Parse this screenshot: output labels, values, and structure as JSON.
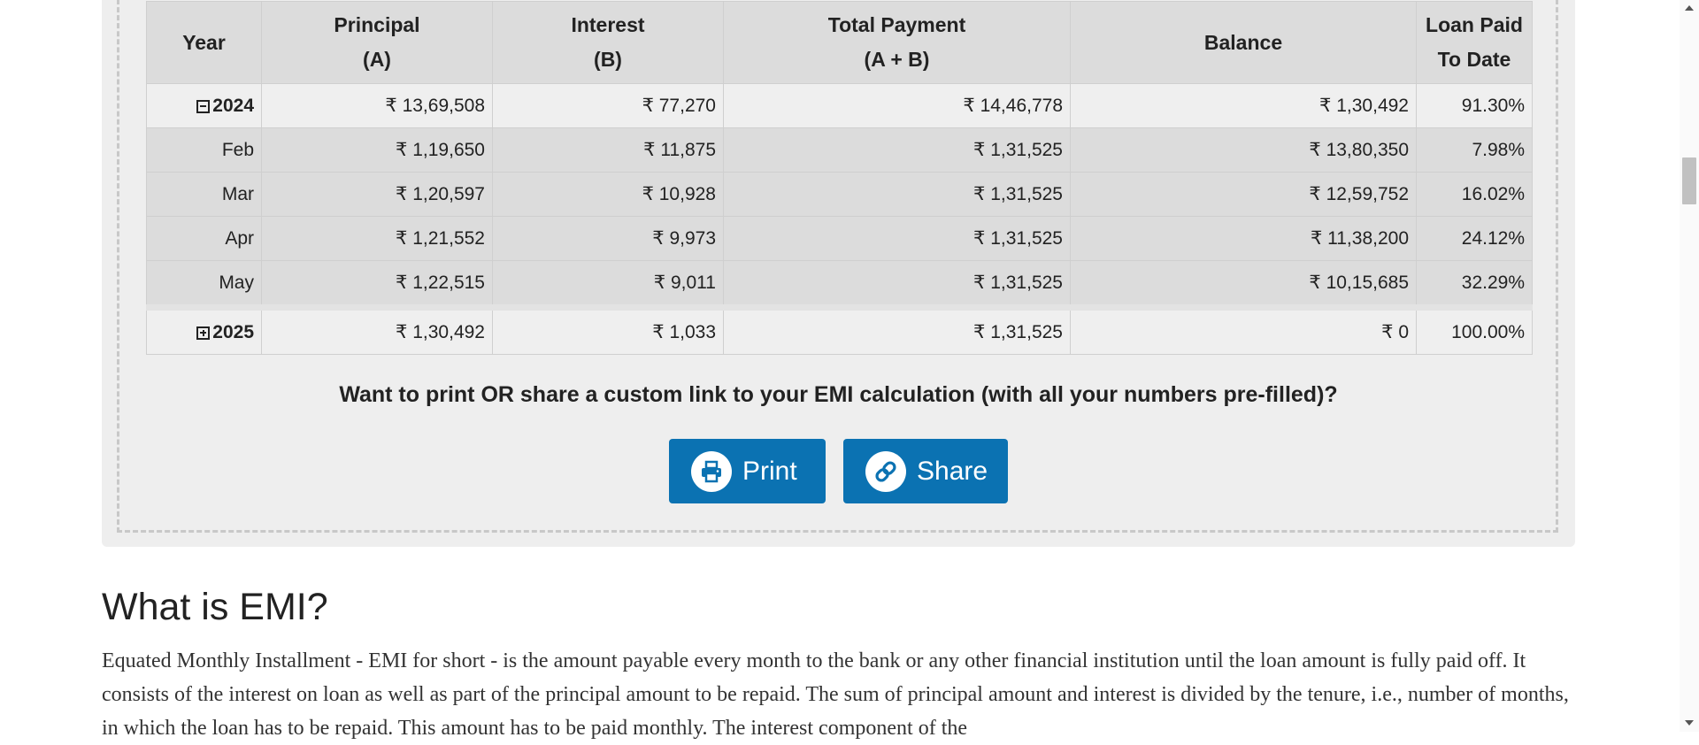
{
  "table": {
    "headers": {
      "year": "Year",
      "principal": "Principal",
      "principal_sub": "(A)",
      "interest": "Interest",
      "interest_sub": "(B)",
      "total": "Total Payment",
      "total_sub": "(A + B)",
      "balance": "Balance",
      "paid": "Loan Paid",
      "paid_sub": "To Date"
    },
    "rows": [
      {
        "label": "2024",
        "principal": "₹ 13,69,508",
        "interest": "₹ 77,270",
        "total": "₹ 14,46,778",
        "balance": "₹ 1,30,492",
        "paid": "91.30%"
      },
      {
        "label": "Feb",
        "principal": "₹ 1,19,650",
        "interest": "₹ 11,875",
        "total": "₹ 1,31,525",
        "balance": "₹ 13,80,350",
        "paid": "7.98%"
      },
      {
        "label": "Mar",
        "principal": "₹ 1,20,597",
        "interest": "₹ 10,928",
        "total": "₹ 1,31,525",
        "balance": "₹ 12,59,752",
        "paid": "16.02%"
      },
      {
        "label": "Apr",
        "principal": "₹ 1,21,552",
        "interest": "₹ 9,973",
        "total": "₹ 1,31,525",
        "balance": "₹ 11,38,200",
        "paid": "24.12%"
      },
      {
        "label": "May",
        "principal": "₹ 1,22,515",
        "interest": "₹ 9,011",
        "total": "₹ 1,31,525",
        "balance": "₹ 10,15,685",
        "paid": "32.29%"
      },
      {
        "label": "2025",
        "principal": "₹ 1,30,492",
        "interest": "₹ 1,033",
        "total": "₹ 1,31,525",
        "balance": "₹ 0",
        "paid": "100.00%"
      }
    ]
  },
  "share": {
    "question": "Want to print OR share a custom link to your EMI calculation (with all your numbers pre-filled)?",
    "print_label": "Print",
    "share_label": "Share"
  },
  "article": {
    "heading": "What is EMI?",
    "paragraph": "Equated Monthly Installment - EMI for short - is the amount payable every month to the bank or any other financial institution until the loan amount is fully paid off. It consists of the interest on loan as well as part of the principal amount to be repaid. The sum of principal amount and interest is divided by the tenure, i.e., number of months, in which the loan has to be repaid. This amount has to be paid monthly. The interest component of the"
  },
  "colors": {
    "principal": "#87a72a",
    "interest": "#ef8d2f",
    "balance": "#ba1f4b",
    "button": "#0b72b2"
  },
  "icons": {
    "print": "printer-icon",
    "share": "link-icon",
    "collapse": "minus-square-icon",
    "expand": "plus-square-icon"
  }
}
